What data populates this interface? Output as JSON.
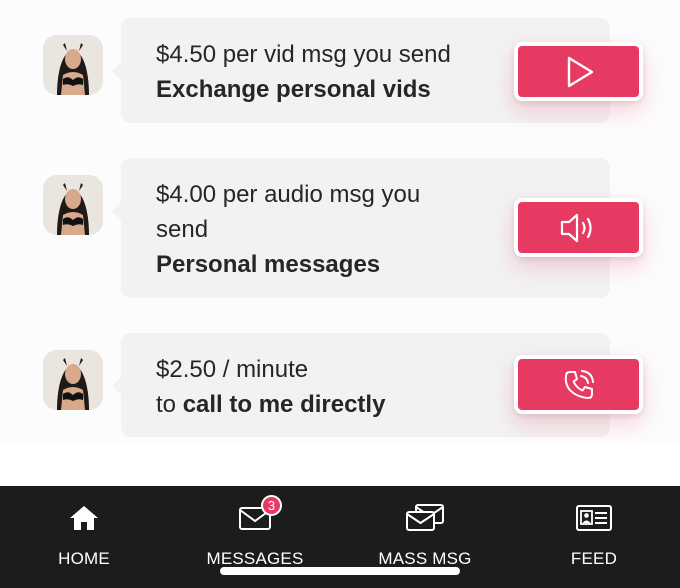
{
  "offers": [
    {
      "price_line": "$4.50 per vid msg you send",
      "title": "Exchange personal vids",
      "action_icon": "play-icon"
    },
    {
      "price_line_1": "$4.00 per audio msg you",
      "price_line_2": "send",
      "title": "Personal messages",
      "action_icon": "speaker-icon"
    },
    {
      "price_line": "$2.50 / minute",
      "prefix": "to",
      "title": "call to me directly",
      "action_icon": "phone-call-icon"
    }
  ],
  "nav": {
    "items": [
      {
        "label": "HOME",
        "icon": "home-icon"
      },
      {
        "label": "MESSAGES",
        "icon": "envelope-icon",
        "badge": "3"
      },
      {
        "label": "MASS MSG",
        "icon": "mass-message-icon"
      },
      {
        "label": "FEED",
        "icon": "id-card-icon"
      }
    ]
  },
  "colors": {
    "accent": "#e63a63",
    "nav_background": "#1c1c1c",
    "bubble_background": "#f2f2f2"
  }
}
